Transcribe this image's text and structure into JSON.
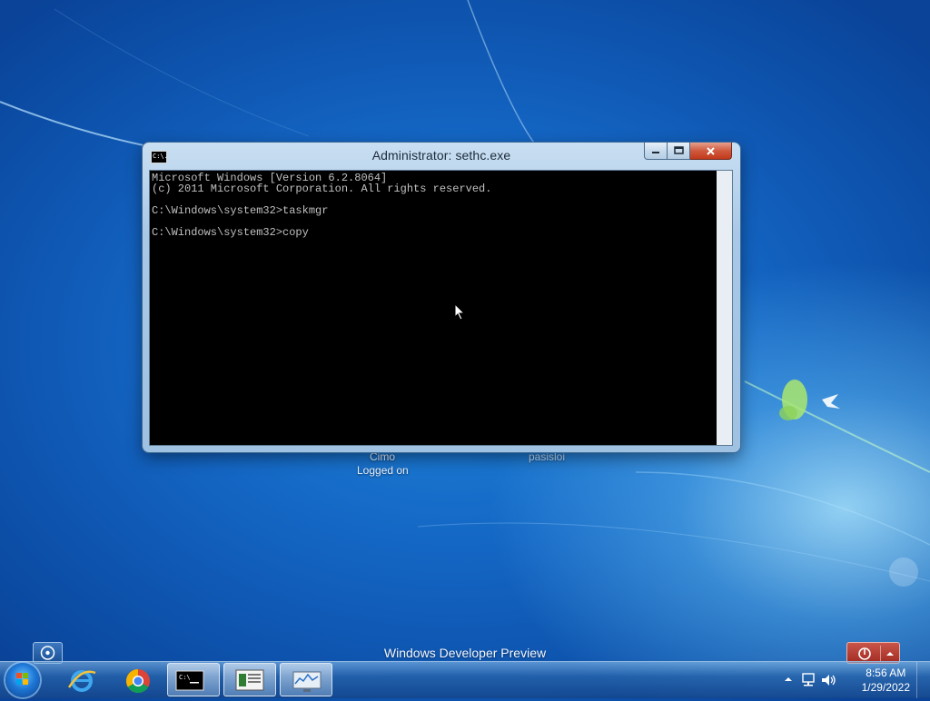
{
  "window": {
    "title": "Administrator: sethc.exe",
    "icon_label": "C:\\.",
    "minimize_icon": "minimize-icon",
    "maximize_icon": "maximize-icon",
    "close_icon": "close-icon"
  },
  "console": {
    "lines": [
      "Microsoft Windows [Version 6.2.8064]",
      "(c) 2011 Microsoft Corporation. All rights reserved.",
      "",
      "C:\\Windows\\system32>taskmgr",
      "",
      "C:\\Windows\\system32>copy"
    ]
  },
  "logon": {
    "user1_name": "Cimo",
    "user1_status": "Logged on",
    "user2_name": "pasisloi"
  },
  "watermark": "Windows Developer Preview",
  "taskbar": {
    "items": [
      "start-orb",
      "internet-explorer-icon",
      "chrome-icon",
      "command-prompt-icon",
      "document-icon",
      "performance-monitor-icon"
    ],
    "clock_time": "8:56 AM",
    "clock_date": "1/29/2022"
  },
  "colors": {
    "desktop": "#1466c4",
    "console_bg": "#000000",
    "console_text": "#c0c0c0",
    "close_button": "#c4391a",
    "power_button": "#a32a22"
  }
}
